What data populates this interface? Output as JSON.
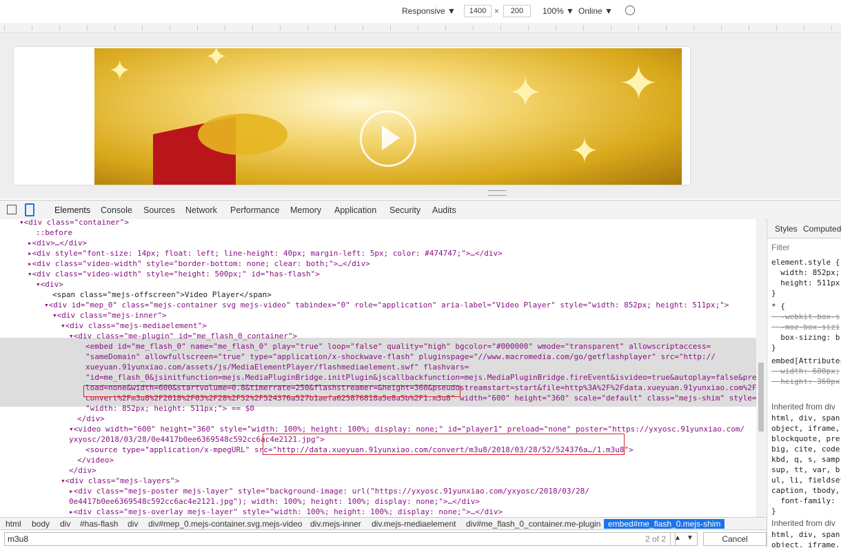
{
  "device_toolbar": {
    "mode": "Responsive",
    "width": "1400",
    "height": "200",
    "times": "×",
    "zoom": "100%",
    "network": "Online"
  },
  "devtools_tabs": [
    "Elements",
    "Console",
    "Sources",
    "Network",
    "Performance",
    "Memory",
    "Application",
    "Security",
    "Audits"
  ],
  "elements_lines": [
    {
      "t": "▾<div class=\"container\">"
    },
    {
      "t": "::before"
    },
    {
      "t": "▸<div>…</div>"
    },
    {
      "t": "▸<div style=\"font-size: 14px; float: left; line-height: 40px; margin-left: 5px; color: #474747;\">…</div>"
    },
    {
      "t": "▸<div class=\"video-width\" style=\"border-bottom: none; clear: both;\">…</div>"
    },
    {
      "t": "▾<div class=\"video-width\" style=\"height: 500px;\" id=\"has-flash\">"
    },
    {
      "t": "▾<div>"
    },
    {
      "t": "<span class=\"mejs-offscreen\">Video Player</span>"
    },
    {
      "t": "▾<div id=\"mep_0\" class=\"mejs-container svg mejs-video\" tabindex=\"0\" role=\"application\" aria-label=\"Video Player\" style=\"width: 852px; height: 511px;\">"
    },
    {
      "t": "▾<div class=\"mejs-inner\">"
    },
    {
      "t": "▾<div class=\"mejs-mediaelement\">"
    },
    {
      "t": "▾<div class=\"me-plugin\" id=\"me_flash_0_container\">"
    },
    {
      "t": "<embed id=\"me_flash_0\" name=\"me_flash_0\" play=\"true\" loop=\"false\" quality=\"high\" bgcolor=\"#000000\" wmode=\"transparent\" allowscriptaccess="
    },
    {
      "t": "\"sameDomain\" allowfullscreen=\"true\" type=\"application/x-shockwave-flash\" pluginspage=\"//www.macromedia.com/go/getflashplayer\" src=\"http://"
    },
    {
      "t": "xueyuan.91yunxiao.com/assets/js/MediaElementPlayer/flashmediaelement.swf\" flashvars="
    },
    {
      "t": "\"id=me_flash_0&jsinitfunction=mejs.MediaPluginBridge.initPlugin&jscallbackfunction=mejs.MediaPluginBridge.fireEvent&isvideo=true&autoplay=false&pre"
    },
    {
      "t": "load=none&width=600&startvolume=0.8&timerrate=250&flashstreamer=&height=360&pseudostreamstart=start&file=http%3A%2F%2Fdata.xueyuan.91yunxiao.com%2F"
    },
    {
      "t": "convert%2Fm3u8%2F2018%2F03%2F28%2F52%2F524376a527b1aefa625876818a5e8a5b%2F1.m3u8\" width=\"600\" height=\"360\" scale=\"default\" class=\"mejs-shim\" style="
    },
    {
      "t": "\"width: 852px; height: 511px;\"> == $0"
    },
    {
      "t": "</div>"
    },
    {
      "t": "▾<video width=\"600\" height=\"360\" style=\"width: 100%; height: 100%; display: none;\" id=\"player1\" preload=\"none\" poster=\"https://yxyosc.91yunxiao.com/"
    },
    {
      "t": "yxyosc/2018/03/28/0e4417b0ee6369548c592cc6ac4e2121.jpg\">"
    },
    {
      "t": "<source type=\"application/x-mpegURL\" src=\"http://data.xueyuan.91yunxiao.com/convert/m3u8/2018/03/28/52/524376a…/1.m3u8\">"
    },
    {
      "t": "</video>"
    },
    {
      "t": "</div>"
    },
    {
      "t": "▾<div class=\"mejs-layers\">"
    },
    {
      "t": "▸<div class=\"mejs-poster mejs-layer\" style=\"background-image: url(\"https://yxyosc.91yunxiao.com/yxyosc/2018/03/28/"
    },
    {
      "t": "0e4417b0ee6369548c592cc6ac4e2121.jpg\"); width: 100%; height: 100%; display: none;\">…</div>"
    },
    {
      "t": "▸<div class=\"mejs-overlay mejs-layer\" style=\"width: 100%; height: 100%; display: none;\">…</div>"
    },
    {
      "t": "▸<div class=\"mejs-overlay mejs-layer\" style=\"display: none; width: 100%; height: 100%;\">…</div>"
    }
  ],
  "styles_panel": {
    "tabs": [
      "Styles",
      "Computed"
    ],
    "filter_placeholder": "Filter",
    "rows": [
      "element.style {",
      "  width: 852px;",
      "  height: 511px;",
      "}",
      "* {",
      "  -webkit-box-s",
      "  -moz-box-sizi",
      "  box-sizing: b",
      "}",
      "embed[Attributes",
      "  width: 600px;",
      "  height: 360px",
      "Inherited from div",
      "html, div, span,",
      "object, iframe,",
      "blockquote, pre,",
      "big, cite, code,",
      "kbd, q, s, samp,",
      "sup, tt, var, b,",
      "ul, li, fieldset",
      "caption, tbody,",
      "  font-family:",
      "}",
      "Inherited from div",
      "html, div, span,",
      "object, iframe,"
    ]
  },
  "breadcrumbs": [
    "html",
    "body",
    "div",
    "#has-flash",
    "div",
    "div#mep_0.mejs-container.svg.mejs-video",
    "div.mejs-inner",
    "div.mejs-mediaelement",
    "div#me_flash_0_container.me-plugin",
    "embed#me_flash_0.mejs-shim"
  ],
  "search": {
    "query": "m3u8",
    "count": "2 of 2",
    "up": "▲",
    "down": "▼",
    "cancel": "Cancel"
  }
}
